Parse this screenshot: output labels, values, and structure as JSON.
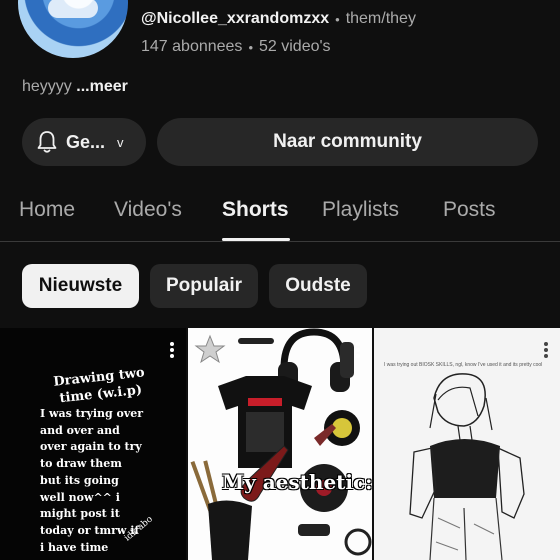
{
  "channel": {
    "handle": "@Nicollee_xxrandomzxx",
    "pronouns": "them/they",
    "subscribers": "147 abonnees",
    "videos": "52 video's",
    "separator": "•",
    "bio": "heyyyy",
    "bio_more": "...meer"
  },
  "actions": {
    "subscribed_label": "Ge...",
    "chevron": "v",
    "community_label": "Naar community"
  },
  "tabs": [
    {
      "label": "Home",
      "active": false
    },
    {
      "label": "Video's",
      "active": false
    },
    {
      "label": "Shorts",
      "active": true
    },
    {
      "label": "Playlists",
      "active": false
    },
    {
      "label": "Posts",
      "active": false
    }
  ],
  "filters": [
    {
      "label": "Nieuwste",
      "selected": true
    },
    {
      "label": "Populair",
      "selected": false
    },
    {
      "label": "Oudste",
      "selected": false
    }
  ],
  "shorts": [
    {
      "title": "Drawing two time (w.i.p)",
      "text": "I was trying over and over and over again to try to draw them but its going well now^^ i might post it today or tmrw if i have time",
      "side_text": "idk abo"
    },
    {
      "overlay": "My aesthetic:"
    },
    {
      "caption": "I was trying out BIOSK SKILLS, ngl, know I've used it and its pretty cool"
    }
  ],
  "colors": {
    "background": "#0f0f0f",
    "surface": "#272727",
    "text_primary": "#f1f1f1",
    "text_secondary": "#aaaaaa",
    "chip_selected_bg": "#f1f1f1"
  },
  "icons": {
    "bell": "bell-icon",
    "more": "more-vert-icon"
  }
}
